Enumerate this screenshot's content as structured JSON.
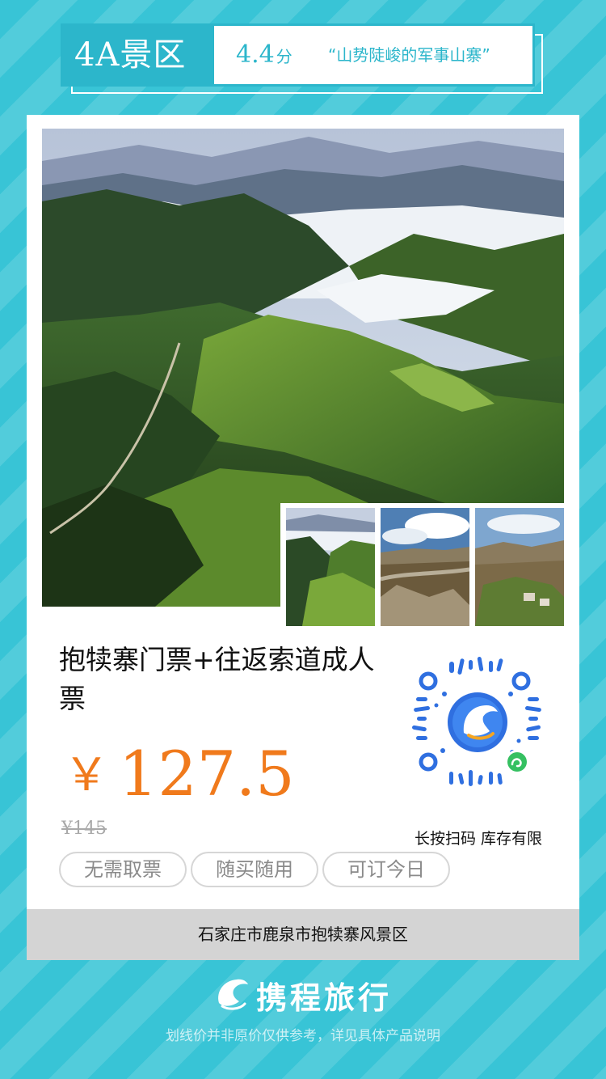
{
  "header": {
    "level": "4A景区",
    "score": "4.4",
    "score_unit": "分",
    "quote": "“山势陡峻的军事山寨”"
  },
  "product": {
    "title": "抱犊寨门票+往返索道成人票",
    "price_symbol": "￥",
    "price": "127.5",
    "original_price": "¥145",
    "tags": [
      "无需取票",
      "随买随用",
      "可订今日"
    ],
    "qr_note": "长按扫码 库存有限",
    "location": "石家庄市鹿泉市抱犊寨风景区"
  },
  "images": {
    "hero": "mountain-valley-cloud-sea-photo",
    "thumbs": [
      "mountain-cloud-thumb",
      "great-wall-cliff-thumb",
      "village-hills-thumb"
    ]
  },
  "brand": {
    "name": "携程旅行",
    "logo": "dolphin-logo-icon",
    "disclaimer": "划线价并非原价仅供参考，详见具体产品说明"
  },
  "colors": {
    "accent": "#2cb6cb",
    "background": "#38c4d6",
    "price": "#f07a1c",
    "qr": "#2f6fe0"
  }
}
